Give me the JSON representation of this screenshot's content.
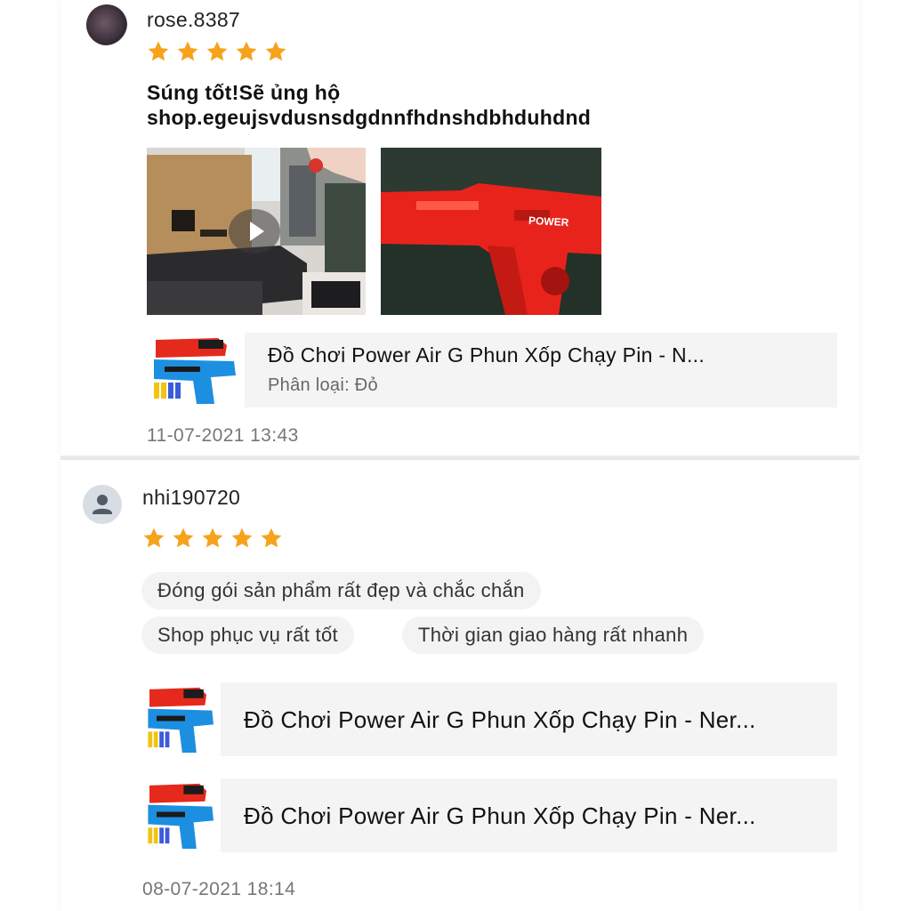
{
  "reviews": [
    {
      "username": "rose.8387",
      "rating": 5,
      "text_line1": "Súng tốt!Sẽ ủng hộ",
      "text_line2": "shop.egeujsvdusnsdgdnnfhdnshdbhduhdnd",
      "media": [
        {
          "type": "video",
          "icon": "play-icon"
        },
        {
          "type": "image",
          "caption": "POWER"
        }
      ],
      "product": {
        "name": "Đồ Chơi Power Air G Phun Xốp Chạy Pin - N...",
        "variant": "Phân loại: Đỏ"
      },
      "date": "11-07-2021 13:43"
    },
    {
      "username": "nhi190720",
      "rating": 5,
      "tags": [
        "Đóng gói sản phẩm rất đẹp và chắc chắn",
        "Shop phục vụ rất tốt",
        "Thời gian giao hàng rất nhanh"
      ],
      "products": [
        {
          "name": "Đồ Chơi Power Air G Phun Xốp Chạy Pin - Ner..."
        },
        {
          "name": "Đồ Chơi Power Air G Phun Xốp Chạy Pin - Ner..."
        }
      ],
      "date": "08-07-2021 18:14"
    }
  ],
  "colors": {
    "star": "#f6a21a",
    "card_bg": "#f4f4f4",
    "tag_bg": "#f3f3f3",
    "date_text": "#777777"
  },
  "icons": {
    "star": "star-icon",
    "default_avatar": "user-icon",
    "play": "play-icon"
  }
}
